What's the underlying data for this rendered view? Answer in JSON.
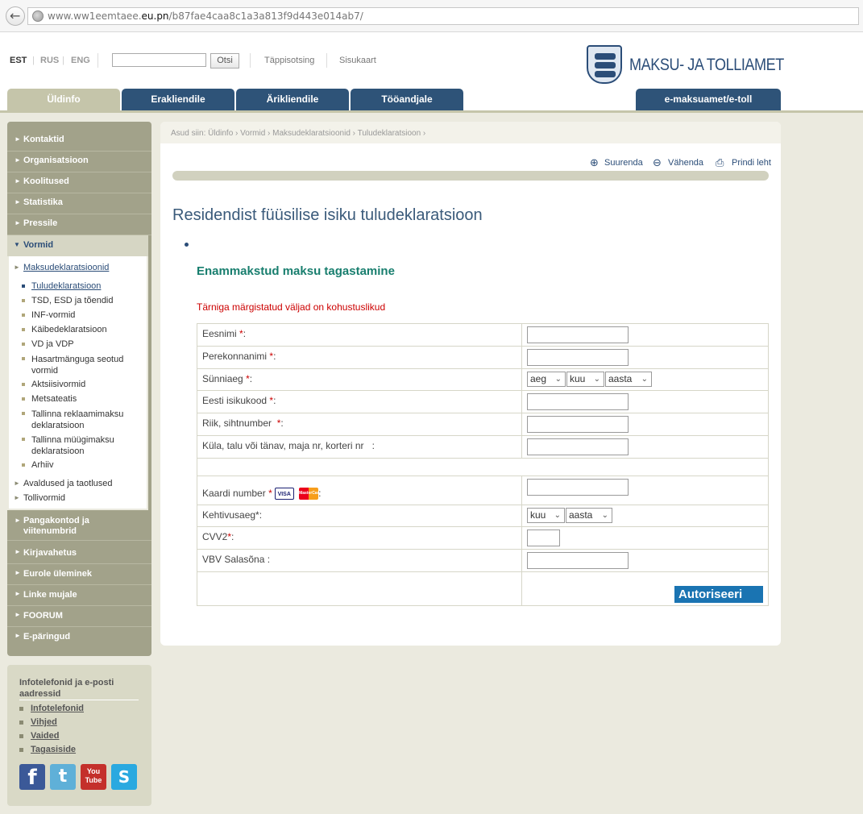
{
  "browser": {
    "url_prefix": "www.ww1eemtaee.",
    "url_host": "eu.pn",
    "url_path": "/b87fae4caa8c1a3a813f9d443e014ab7/"
  },
  "header": {
    "languages": [
      "EST",
      "RUS",
      "ENG"
    ],
    "search_button": "Otsi",
    "advanced_search": "Täppisotsing",
    "sitemap": "Sisukaart",
    "logo_text": "MAKSU- JA TOLLIAMET"
  },
  "tabs": [
    "Üldinfo",
    "Erakliendile",
    "Ärikliendile",
    "Tööandjale",
    "e-maksuamet/e-toll"
  ],
  "sidebar": {
    "top_items": [
      "Kontaktid",
      "Organisatsioon",
      "Koolitused",
      "Statistika",
      "Pressile"
    ],
    "open_item": "Vormid",
    "sub_head": "Maksudeklaratsioonid",
    "sub_items": [
      "Tuludeklaratsioon",
      "TSD, ESD ja tõendid",
      "INF-vormid",
      "Käibedeklaratsioon",
      "VD ja VDP",
      "Hasartmänguga seotud vormid",
      "Aktsiisivormid",
      "Metsateatis",
      "Tallinna reklaamimaksu deklaratsioon",
      "Tallinna müügimaksu deklaratsioon",
      "Arhiiv"
    ],
    "sub_extra": [
      "Avaldused ja taotlused",
      "Tollivormid"
    ],
    "bottom_items": [
      "Pangakontod ja viitenumbrid",
      "Kirjavahetus",
      "Eurole üleminek",
      "Linke mujale",
      "FOORUM",
      "E-päringud"
    ]
  },
  "info": {
    "title": "Infotelefonid ja e-posti aadressid",
    "links": [
      "Infotelefonid",
      "Vihjed",
      "Vaided",
      "Tagasiside"
    ],
    "social": [
      "facebook-icon",
      "twitter-icon",
      "youtube-icon",
      "skype-icon"
    ]
  },
  "content": {
    "breadcrumb": "Asud siin: Üldinfo › Vormid › Maksudeklaratsioonid › Tuludeklaratsioon ›",
    "tools": [
      "Suurenda",
      "Vähenda",
      "Prindi leht"
    ],
    "title": "Residendist füüsilise isiku tuludeklaratsioon",
    "form_title": "Enammakstud maksu tagastamine",
    "required_note": "Tärniga märgistatud väljad on kohustuslikud",
    "fields": {
      "first_name": "Eesnimi",
      "last_name": "Perekonnanimi",
      "birth_date": "Sünniaeg",
      "id_code": "Eesti isikukood",
      "country_zip": "Riik, sihtnumber",
      "address": "Küla, talu või tänav, maja nr, korteri nr",
      "address_suffix": ":",
      "card_number": "Kaardi number",
      "expiry": "Kehtivusaeg",
      "cvv": "CVV2",
      "vbv": "VBV Salasõna :"
    },
    "selects": {
      "day": "aeg",
      "month": "kuu",
      "year": "aasta"
    },
    "card_brands": [
      "VISA",
      "MasterCard"
    ],
    "submit": "Autoriseeri"
  }
}
